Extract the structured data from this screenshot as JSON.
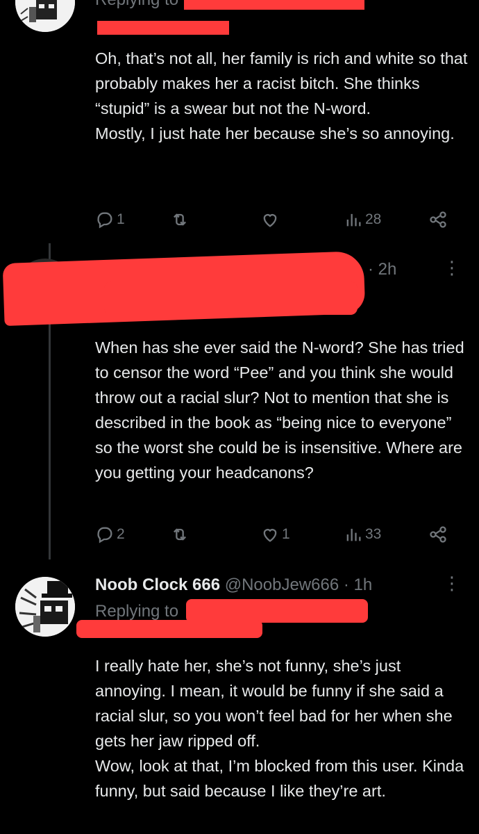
{
  "tweets": [
    {
      "replying": "Replying to",
      "body": [
        "Oh, that’s not all, her family is rich and white so that probably makes her a racist bitch. She thinks “stupid” is a swear but not the N-word.",
        "Mostly, I just hate her because she’s so annoying."
      ],
      "stats": {
        "replies": "1",
        "retweets": "",
        "likes": "",
        "views": "28"
      }
    },
    {
      "time": "· 2h",
      "body": [
        "When has she ever said the N-word? She has tried to censor the word “Pee” and you think she would throw out a racial slur? Not to mention that she is described in the book as “being nice to everyone” so the worst she could be is insensitive. Where are you getting your headcanons?"
      ],
      "stats": {
        "replies": "2",
        "retweets": "",
        "likes": "1",
        "views": "33"
      }
    },
    {
      "display_name": "Noob Clock 666",
      "handle": "@NoobJew666",
      "time": "· 1h",
      "replying": "Replying to",
      "body": [
        "I really hate her, she’s not funny, she’s just annoying. I mean, it would be funny if she said a racial slur, so you won’t feel bad for her when she gets her jaw ripped off.",
        "Wow, look at that, I’m blocked from this user. Kinda funny, but said because I like they’re art."
      ]
    }
  ],
  "colors": {
    "background": "#000000",
    "text": "#e7e9ea",
    "muted": "#71767b",
    "redaction": "#ff3b3b"
  },
  "icons": [
    "reply-icon",
    "retweet-icon",
    "like-icon",
    "views-icon",
    "share-icon",
    "more-icon"
  ]
}
